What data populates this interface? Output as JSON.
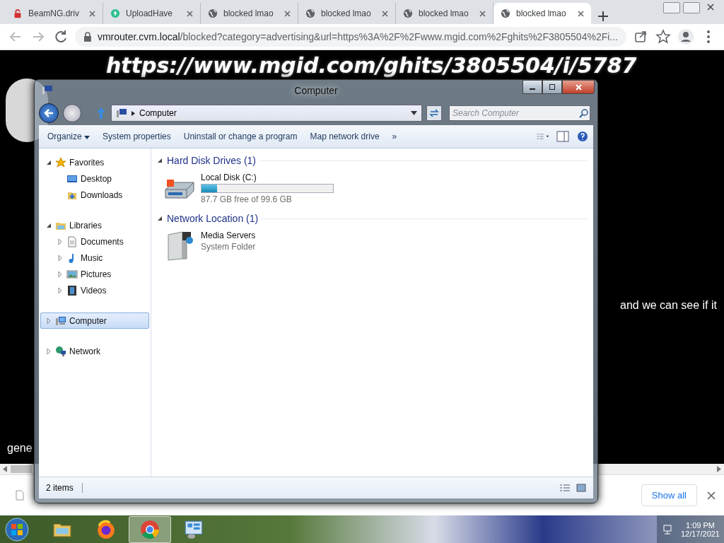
{
  "browser": {
    "tabs": [
      {
        "title": "BeamNG.driv",
        "kind": "lock",
        "selected": false
      },
      {
        "title": "UploadHave",
        "kind": "upload",
        "selected": false
      },
      {
        "title": "blocked lmao",
        "kind": "globe",
        "selected": false
      },
      {
        "title": "blocked lmao",
        "kind": "globe",
        "selected": false
      },
      {
        "title": "blocked lmao",
        "kind": "globe",
        "selected": false
      },
      {
        "title": "blocked lmao",
        "kind": "globe",
        "selected": true
      }
    ],
    "url_host": "vmrouter.cvm.local",
    "url_rest": "/blocked?category=advertising&url=https%3A%2F%2Fwww.mgid.com%2Fghits%2F3805504%2Fi..."
  },
  "page": {
    "heading": "https://www.mgid.com/ghits/3805504/i/5787",
    "line_right": "and we can see if it",
    "line_left": "gene"
  },
  "downloads": {
    "show_all": "Show all"
  },
  "explorer": {
    "title": "Computer",
    "address": "Computer",
    "search": {
      "placeholder": "Search Computer"
    },
    "toolbar": [
      {
        "label": "Organize",
        "kind": "menu"
      },
      {
        "label": "System properties",
        "kind": "plain"
      },
      {
        "label": "Uninstall or change a program",
        "kind": "plain"
      },
      {
        "label": "Map network drive",
        "kind": "plain"
      },
      {
        "label": "»",
        "kind": "plain"
      }
    ],
    "tree": [
      {
        "label": "Favorites",
        "kind": "favorites",
        "expanded": true,
        "selected": false,
        "children": [
          {
            "label": "Desktop",
            "kind": "desktop",
            "selected": false
          },
          {
            "label": "Downloads",
            "kind": "downloads",
            "selected": false
          }
        ]
      },
      {
        "label": "Libraries",
        "kind": "libraries",
        "expanded": true,
        "selected": false,
        "children": [
          {
            "label": "Documents",
            "kind": "documents",
            "expanded": false,
            "selected": false
          },
          {
            "label": "Music",
            "kind": "music",
            "expanded": false,
            "selected": false
          },
          {
            "label": "Pictures",
            "kind": "pictures",
            "expanded": false,
            "selected": false
          },
          {
            "label": "Videos",
            "kind": "videos",
            "expanded": false,
            "selected": false
          }
        ]
      },
      {
        "label": "Computer",
        "kind": "computer",
        "expanded": false,
        "selected": true
      },
      {
        "label": "Network",
        "kind": "network",
        "expanded": false,
        "selected": false
      }
    ],
    "groups": [
      {
        "title": "Hard Disk Drives (1)",
        "expanded": true,
        "items": [
          {
            "kind": "disk",
            "name": "Local Disk (C:)",
            "level": 0.12,
            "detail": "87.7 GB free of 99.6 GB"
          }
        ]
      },
      {
        "title": "Network Location (1)",
        "expanded": true,
        "items": [
          {
            "kind": "server",
            "name": "Media Servers",
            "detail": "System Folder"
          }
        ]
      }
    ],
    "status": "2 items"
  },
  "taskbar": {
    "apps": [
      {
        "kind": "folder",
        "active": false
      },
      {
        "kind": "firefox",
        "active": false
      },
      {
        "kind": "chrome",
        "active": true
      },
      {
        "kind": "panel",
        "active": false
      }
    ],
    "time": "1:09 PM",
    "date": "12/17/2021"
  }
}
